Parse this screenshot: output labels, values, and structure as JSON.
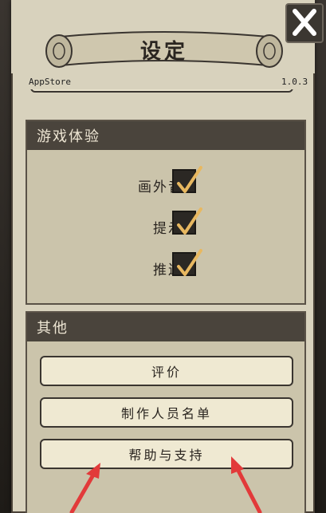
{
  "header": {
    "title": "设定",
    "store": "AppStore",
    "version": "1.0.3"
  },
  "close_button": {
    "icon": "close-icon"
  },
  "sections": {
    "experience": {
      "title": "游戏体验",
      "toggles": [
        {
          "label": "画外音",
          "checked": true
        },
        {
          "label": "提示",
          "checked": true
        },
        {
          "label": "推送",
          "checked": true
        }
      ]
    },
    "other": {
      "title": "其他",
      "buttons": [
        {
          "label": "评价"
        },
        {
          "label": "制作人员名单"
        },
        {
          "label": "帮助与支持"
        }
      ]
    }
  },
  "colors": {
    "accent_check": "#e8b860",
    "annotation_arrow": "#e23a3a",
    "panel": "#d8d2bd",
    "section_header": "#4a443c"
  }
}
